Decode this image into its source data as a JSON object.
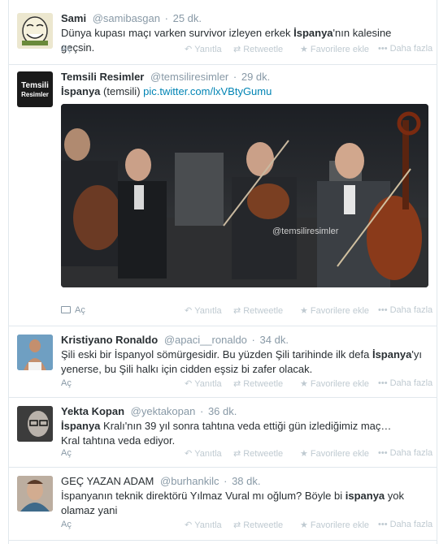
{
  "actions": {
    "expand": "Aç",
    "reply": "Yanıtla",
    "retweet": "Retweetle",
    "favorite": "Favorilere ekle",
    "more": "Daha fazla"
  },
  "tweets": [
    {
      "fullname": "Sami",
      "username": "@samibasgan",
      "time": "25 dk.",
      "text_parts": [
        "Dünya kupası maçı varken survivor izleyen erkek ",
        "İspanya",
        "'nın kalesine geçsin."
      ]
    },
    {
      "fullname": "Temsili Resimler",
      "username": "@temsiliresimler",
      "time": "29 dk.",
      "text_parts": [
        "İspanya",
        " (temsili) ",
        "pic.twitter.com/lxVBtyGumu"
      ],
      "avatar_text": [
        "Temsili",
        "Resimler"
      ],
      "photo_watermark": "@temsiliresimler"
    },
    {
      "fullname": "Kristiyano Ronaldo",
      "username": "@apaci__ronaldo",
      "time": "34 dk.",
      "text_parts": [
        "Şili eski bir İspanyol sömürgesidir. Bu yüzden Şili tarihinde ilk defa ",
        "İspanya",
        "'yı yenerse, bu Şili halkı için cidden eşsiz bi zafer olacak."
      ]
    },
    {
      "fullname": "Yekta Kopan",
      "username": "@yektakopan",
      "time": "36 dk.",
      "text_parts": [
        "İspanya",
        " Kralı'nın 39 yıl sonra tahtına veda ettiği gün izlediğimiz maç…",
        "Kral tahtına veda ediyor."
      ]
    },
    {
      "fullname": "GEÇ YAZAN ADAM",
      "username": "@burhankilc",
      "time": "38 dk.",
      "text_parts": [
        "İspanyanın teknik direktörü Yılmaz Vural mı oğlum? Böyle bi ",
        "ispanya",
        " yok olamaz yani"
      ]
    }
  ],
  "colors": {
    "link": "#0084b4",
    "muted": "#8899a6",
    "action": "#bfcad1",
    "border": "#e1e8ed"
  }
}
